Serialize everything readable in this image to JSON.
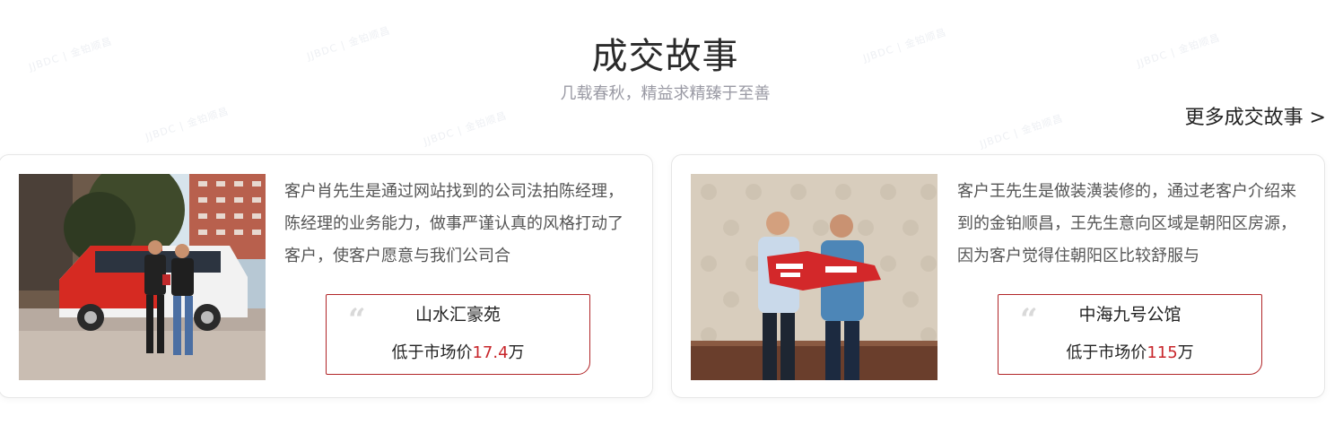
{
  "section": {
    "title": "成交故事",
    "subtitle": "几载春秋，精益求精臻于至善",
    "more_link": "更多成交故事 >"
  },
  "watermark": "JJBDC | 金铂顺昌",
  "stories": [
    {
      "description": "客户肖先生是通过网站找到的公司法拍陈经理，陈经理的业务能力，做事严谨认真的风格打动了客户，使客户愿意与我们公司合",
      "estate": "山水汇豪苑",
      "price_prefix": "低于市场价",
      "price_value": "17.4",
      "price_unit": "万"
    },
    {
      "description": "客户王先生是做装潢装修的，通过老客户介绍来到的金铂顺昌，王先生意向区域是朝阳区房源，因为客户觉得住朝阳区比较舒服与",
      "estate": "中海九号公馆",
      "price_prefix": "低于市场价",
      "price_value": "115",
      "price_unit": "万"
    }
  ],
  "colors": {
    "accent_red": "#c8262b",
    "border_red": "#b12528",
    "title": "#2a2a2a",
    "subtitle": "#9a9aa4"
  }
}
